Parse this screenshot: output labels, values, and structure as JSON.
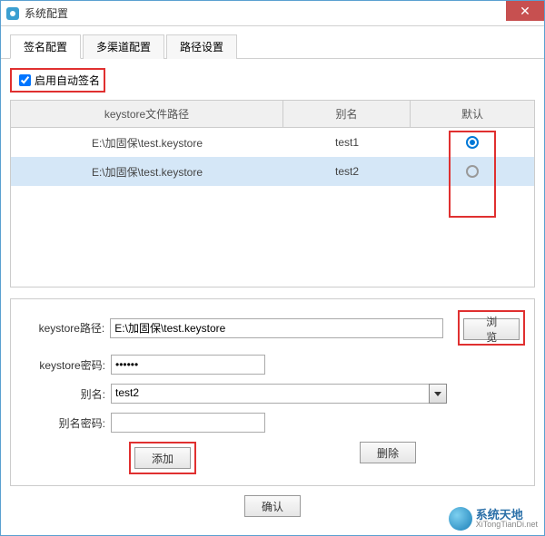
{
  "window": {
    "title": "系统配置",
    "close": "✕"
  },
  "tabs": [
    {
      "label": "签名配置",
      "active": true
    },
    {
      "label": "多渠道配置",
      "active": false
    },
    {
      "label": "路径设置",
      "active": false
    }
  ],
  "autoSign": {
    "label": "启用自动签名",
    "checked": true
  },
  "table": {
    "headers": {
      "path": "keystore文件路径",
      "alias": "别名",
      "default": "默认"
    },
    "rows": [
      {
        "path": "E:\\加固保\\test.keystore",
        "alias": "test1",
        "selected": true
      },
      {
        "path": "E:\\加固保\\test.keystore",
        "alias": "test2",
        "selected": false
      }
    ]
  },
  "form": {
    "pathLabel": "keystore路径:",
    "pathValue": "E:\\加固保\\test.keystore",
    "browse": "浏览",
    "pwdLabel": "keystore密码:",
    "pwdValue": "••••••",
    "aliasLabel": "别名:",
    "aliasValue": "test2",
    "aliasPwdLabel": "别名密码:",
    "aliasPwdValue": "",
    "add": "添加",
    "delete": "删除"
  },
  "confirm": "确认",
  "watermark": {
    "main": "系统天地",
    "sub": "XiTongTianDi.net"
  }
}
